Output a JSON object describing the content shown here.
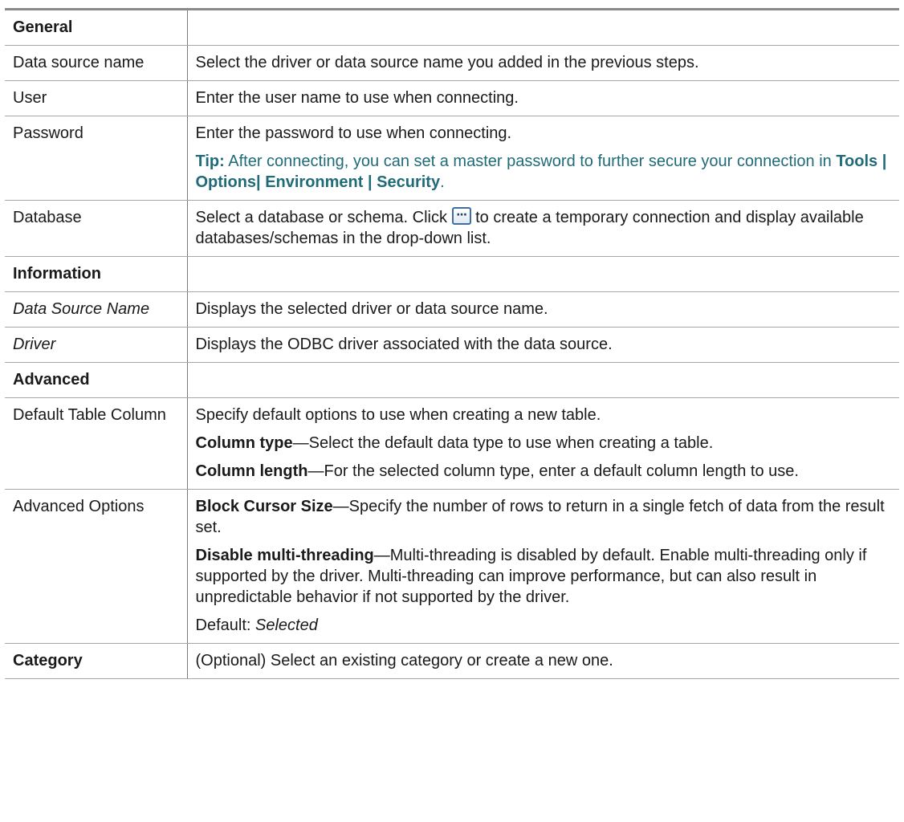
{
  "sections": {
    "general": "General",
    "information": "Information",
    "advanced": "Advanced",
    "category": "Category"
  },
  "general": {
    "dsn": {
      "label": "Data source name",
      "desc": "Select the driver or data source name you added in the previous steps."
    },
    "user": {
      "label": "User",
      "desc": "Enter the user name to use when connecting."
    },
    "password": {
      "label": "Password",
      "desc": "Enter the password to use when connecting.",
      "tip_label": "Tip:",
      "tip_text": " After connecting, you can set a master password to further secure your connection in ",
      "tip_path": "Tools | Options| Environment | Security",
      "tip_end": "."
    },
    "database": {
      "label": "Database",
      "desc_before": "Select a database or schema. Click ",
      "desc_after": " to create a temporary connection and display available databases/schemas in the drop-down list.",
      "icon": "ellipsis-button-icon"
    }
  },
  "information": {
    "dsn": {
      "label": "Data Source Name",
      "desc": "Displays the selected driver or data source name."
    },
    "driver": {
      "label": "Driver",
      "desc": "Displays the ODBC driver associated with the data source."
    }
  },
  "advanced": {
    "default_table_column": {
      "label": "Default Table Column",
      "intro": "Specify default options to use when creating a new table.",
      "column_type_label": "Column type",
      "column_type_desc": "—Select the default data type to use when creating a table.",
      "column_length_label": "Column length",
      "column_length_desc": "—For the selected column type, enter a default column length to use."
    },
    "advanced_options": {
      "label": "Advanced Options",
      "block_cursor_label": "Block Cursor Size",
      "block_cursor_desc": "—Specify the number of rows to return in a single fetch of data from the result set.",
      "multithread_label": "Disable multi-threading",
      "multithread_desc": "—Multi-threading is disabled by default. Enable multi-threading only if supported by the driver. Multi-threading can improve performance, but can also result in unpredictable behavior if not supported by the driver.",
      "default_label": "Default: ",
      "default_value": "Selected"
    }
  },
  "category": {
    "desc": "(Optional) Select an existing category or create a new one."
  },
  "colors": {
    "tip": "#1f6b78",
    "border_top": "#8a8a8a",
    "border_row": "#a6a6a6",
    "border_col": "#7a7a7a"
  }
}
